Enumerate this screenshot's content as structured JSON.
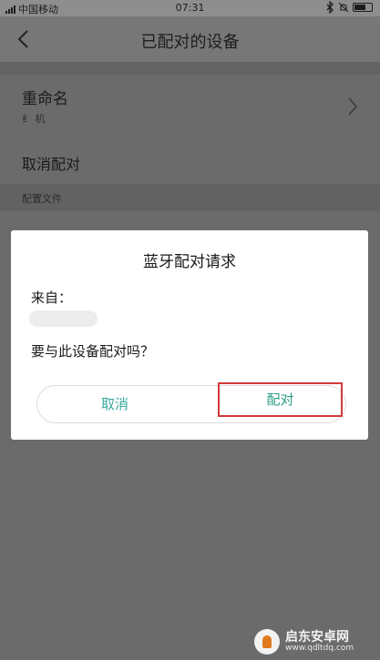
{
  "status_bar": {
    "carrier": "中国移动",
    "time": "07:31"
  },
  "header": {
    "title": "已配对的设备",
    "back_icon": "back-arrow-icon"
  },
  "settings": {
    "rename_label": "重命名",
    "device_name": "纟      机",
    "unpair_label": "取消配对",
    "section_label": "配置文件"
  },
  "dialog": {
    "title": "蓝牙配对请求",
    "from_label": "来自：",
    "question": "要与此设备配对吗？",
    "cancel_label": "取消",
    "pair_label": "配对",
    "highlight_color": "#d23a3a",
    "button_color": "#3aa99c"
  },
  "watermark": {
    "text": "启东安卓网",
    "url": "www.qdltdq.com"
  }
}
